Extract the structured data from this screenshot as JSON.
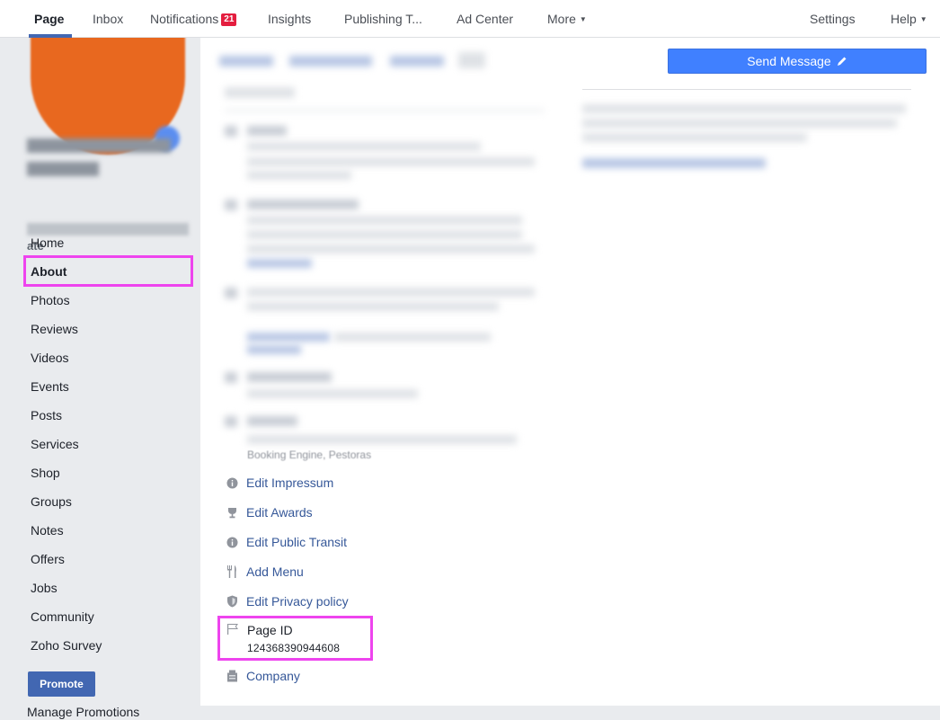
{
  "nav": {
    "page": "Page",
    "inbox": "Inbox",
    "notifications": "Notifications",
    "notifications_count": "21",
    "insights": "Insights",
    "publishing": "Publishing T...",
    "ad_center": "Ad Center",
    "more": "More",
    "settings": "Settings",
    "help": "Help"
  },
  "sidebar": {
    "handle_tail": "ate",
    "items": [
      "Home",
      "About",
      "Photos",
      "Reviews",
      "Videos",
      "Events",
      "Posts",
      "Services",
      "Shop",
      "Groups",
      "Notes",
      "Offers",
      "Jobs",
      "Community",
      "Zoho Survey"
    ],
    "promote": "Promote",
    "manage_promotions": "Manage Promotions"
  },
  "main": {
    "send_message": "Send Message",
    "blur_text": "Booking Engine, Pestoras",
    "edit_impressum": "Edit Impressum",
    "edit_awards": "Edit Awards",
    "edit_public_transit": "Edit Public Transit",
    "add_menu": "Add Menu",
    "edit_privacy_policy": "Edit Privacy policy",
    "page_id_label": "Page ID",
    "page_id_value": "124368390944608",
    "company": "Company"
  },
  "colors": {
    "accent_blue": "#4267b2",
    "send_button_blue": "#4080ff",
    "link_blue": "#365899",
    "highlight_magenta": "#ee44ee",
    "badge_red": "#e41e3f",
    "avatar_orange": "#e8681f"
  }
}
